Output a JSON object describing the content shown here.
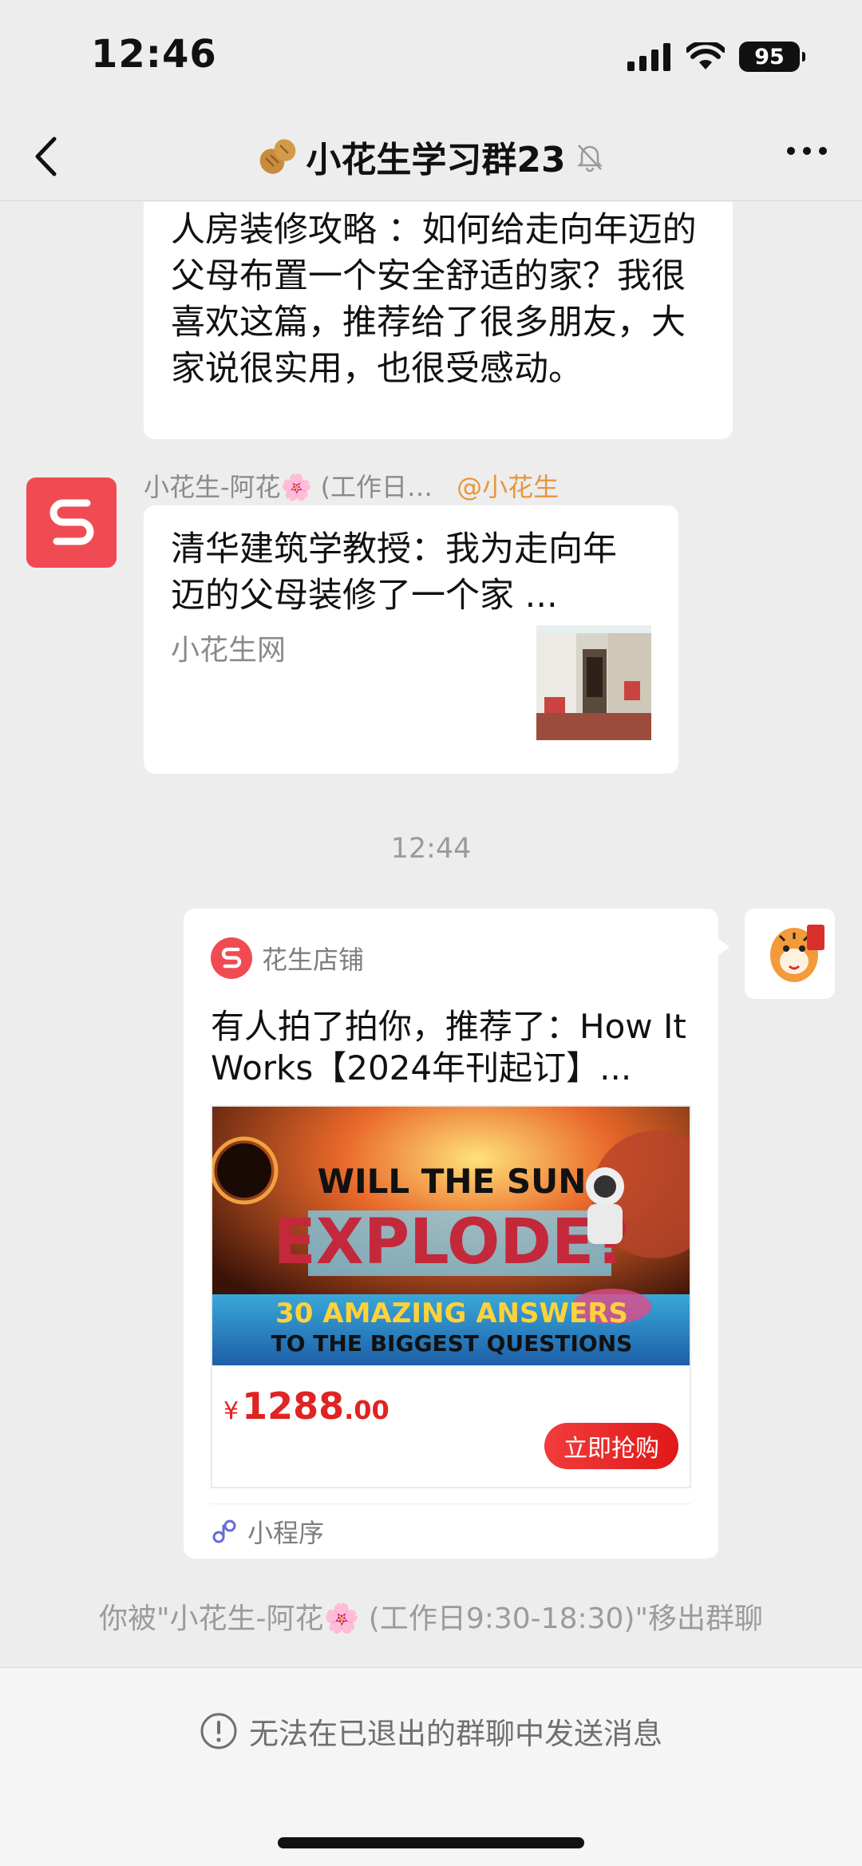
{
  "status_bar": {
    "time": "12:46",
    "battery": "95"
  },
  "header": {
    "title": "小花生学习群23"
  },
  "messages": {
    "m1_text": "人房装修攻略 ：如何给走向年迈的父母布置一个安全舒适的家？我很喜欢这篇，推荐给了很多朋友，大家说很实用，也很受感动。",
    "m2_sender": "小花生-阿花🌸 (工作日…",
    "m2_mention": "@小花生",
    "m2_card_title": "清华建筑学教授：我为走向年迈的父母装修了一个家 ...",
    "m2_card_source": "小花生网",
    "time_separator": "12:44",
    "m3_shop": "花生店铺",
    "m3_title": "有人拍了拍你，推荐了：How It Works【2024年刊起订】...",
    "m3_img_line1": "WILL THE SUN",
    "m3_img_line2": "EXPLODE?",
    "m3_img_line3": "30 AMAZING ANSWERS",
    "m3_img_line4": "TO THE BIGGEST QUESTIONS",
    "m3_price_symbol": "¥",
    "m3_price_int": "1288",
    "m3_price_dec": ".00",
    "m3_buy": "立即抢购",
    "m3_mini": "小程序",
    "system_msg": "你被\"小花生-阿花🌸 (工作日9:30-18:30)\"移出群聊"
  },
  "footer": {
    "notice": "无法在已退出的群聊中发送消息"
  },
  "colors": {
    "accent_red": "#f04b52",
    "price_red": "#e02323",
    "mention_orange": "#e8963c"
  },
  "icons": [
    "back-chevron-icon",
    "peanut-icon",
    "mute-bell-icon",
    "more-dots-icon",
    "signal-icon",
    "wifi-icon",
    "battery-icon",
    "app-logo-icon",
    "tiger-avatar-icon",
    "mini-program-icon",
    "info-circle-icon"
  ]
}
